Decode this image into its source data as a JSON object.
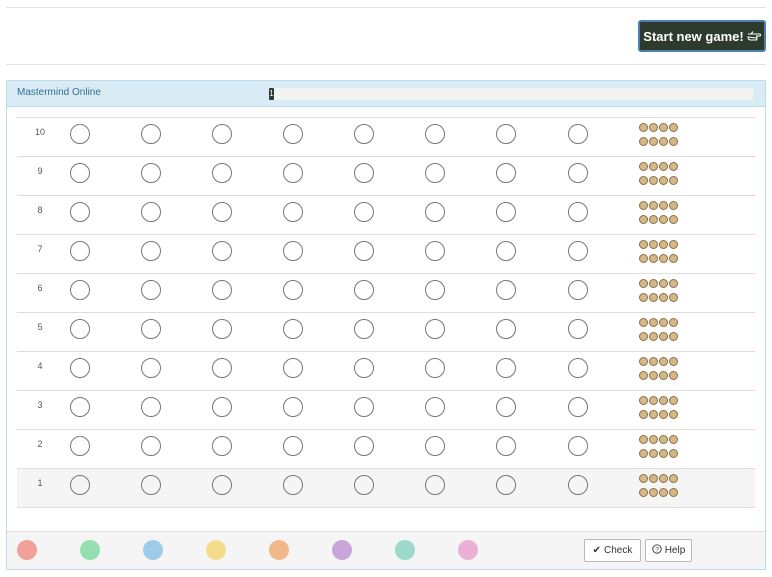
{
  "header": {
    "new_game_label": "Start new game!",
    "new_game_icon": "hand-pointing-icon"
  },
  "panel": {
    "title": "Mastermind Online",
    "timer_text": "1",
    "timer_progress": 0.01
  },
  "board": {
    "rows": [
      {
        "number": "10"
      },
      {
        "number": "9"
      },
      {
        "number": "8"
      },
      {
        "number": "7"
      },
      {
        "number": "6"
      },
      {
        "number": "5"
      },
      {
        "number": "4"
      },
      {
        "number": "3"
      },
      {
        "number": "2"
      },
      {
        "number": "1",
        "active": true
      }
    ],
    "slots_per_row": 8,
    "feedback_pegs_per_row": 8,
    "peg_color": "#d6b788"
  },
  "palette": {
    "colors": [
      "#f0a19a",
      "#94dfb0",
      "#9fcbeb",
      "#f3dc8c",
      "#f0b98c",
      "#c9a6d9",
      "#9ad9cb",
      "#ebb1d4"
    ]
  },
  "footer": {
    "check_label": "Check",
    "check_icon": "checkmark-icon",
    "help_label": "Help",
    "help_icon": "question-circle-icon"
  }
}
